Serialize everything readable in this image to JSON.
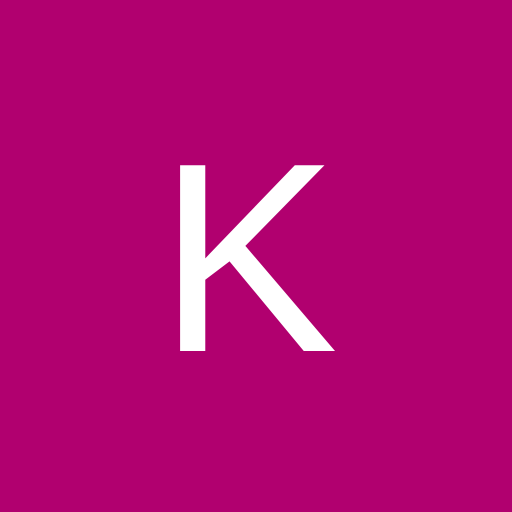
{
  "avatar": {
    "initial": "K",
    "background_color": "#b1006f",
    "text_color": "#ffffff"
  }
}
